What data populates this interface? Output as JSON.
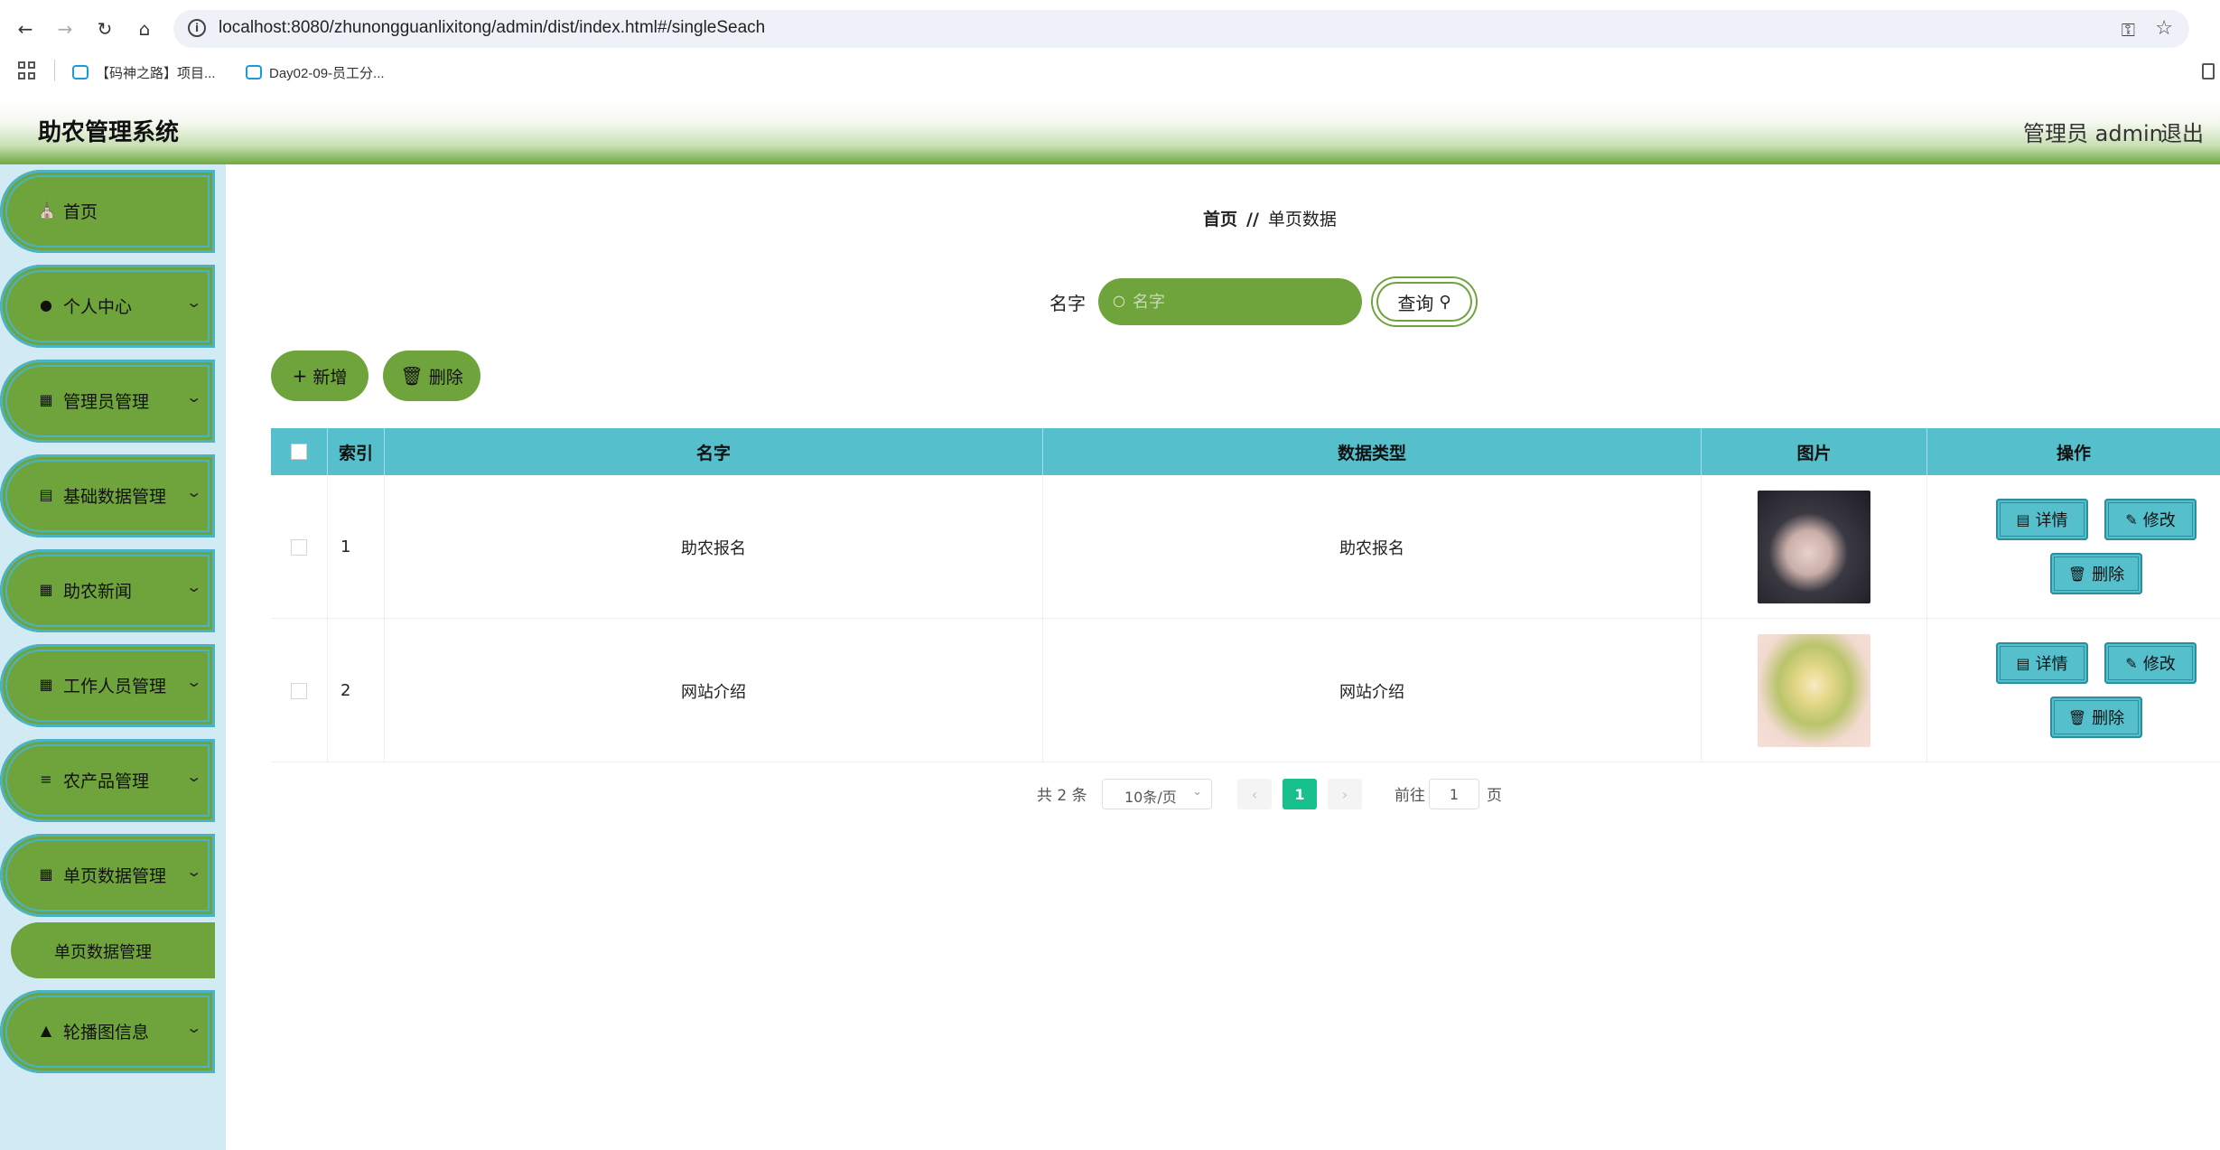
{
  "browser": {
    "url": "localhost:8080/zhunongguanlixitong/admin/dist/index.html#/singleSeach",
    "bookmarks": [
      "【码神之路】项目...",
      "Day02-09-员工分..."
    ]
  },
  "header": {
    "title": "助农管理系统",
    "admin": "管理员 admin",
    "logout": "退出"
  },
  "sidebar": {
    "items": [
      {
        "label": "首页",
        "icon": "home-icon",
        "chevron": false
      },
      {
        "label": "个人中心",
        "icon": "user-icon",
        "chevron": true
      },
      {
        "label": "管理员管理",
        "icon": "grid-icon",
        "chevron": true
      },
      {
        "label": "基础数据管理",
        "icon": "monitor-icon",
        "chevron": true
      },
      {
        "label": "助农新闻",
        "icon": "grid-icon",
        "chevron": true
      },
      {
        "label": "工作人员管理",
        "icon": "grid-icon",
        "chevron": true
      },
      {
        "label": "农产品管理",
        "icon": "sliders-icon",
        "chevron": true
      },
      {
        "label": "单页数据管理",
        "icon": "grid-icon",
        "chevron": true
      },
      {
        "label": "轮播图信息",
        "icon": "chart-icon",
        "chevron": true
      }
    ],
    "sub_item": "单页数据管理"
  },
  "breadcrumb": {
    "home": "首页",
    "separator": "//",
    "current": "单页数据"
  },
  "search": {
    "label": "名字",
    "placeholder": "名字",
    "button": "查询"
  },
  "actions": {
    "add": "新增",
    "delete": "删除"
  },
  "table": {
    "columns": [
      "索引",
      "名字",
      "数据类型",
      "图片",
      "操作"
    ],
    "rows": [
      {
        "index": "1",
        "name": "助农报名",
        "type": "助农报名"
      },
      {
        "index": "2",
        "name": "网站介绍",
        "type": "网站介绍"
      }
    ],
    "ops": {
      "detail": "详情",
      "edit": "修改",
      "delete": "删除"
    }
  },
  "pagination": {
    "total": "共 2 条",
    "page_size": "10条/页",
    "current_page": "1",
    "goto_label": "前往",
    "goto_value": "1",
    "page_unit": "页"
  },
  "colors": {
    "menu_green": "#6fa43c",
    "table_header": "#55bfcc",
    "sidebar_bg": "#d2eaf3",
    "pager_active": "#18c08e"
  }
}
